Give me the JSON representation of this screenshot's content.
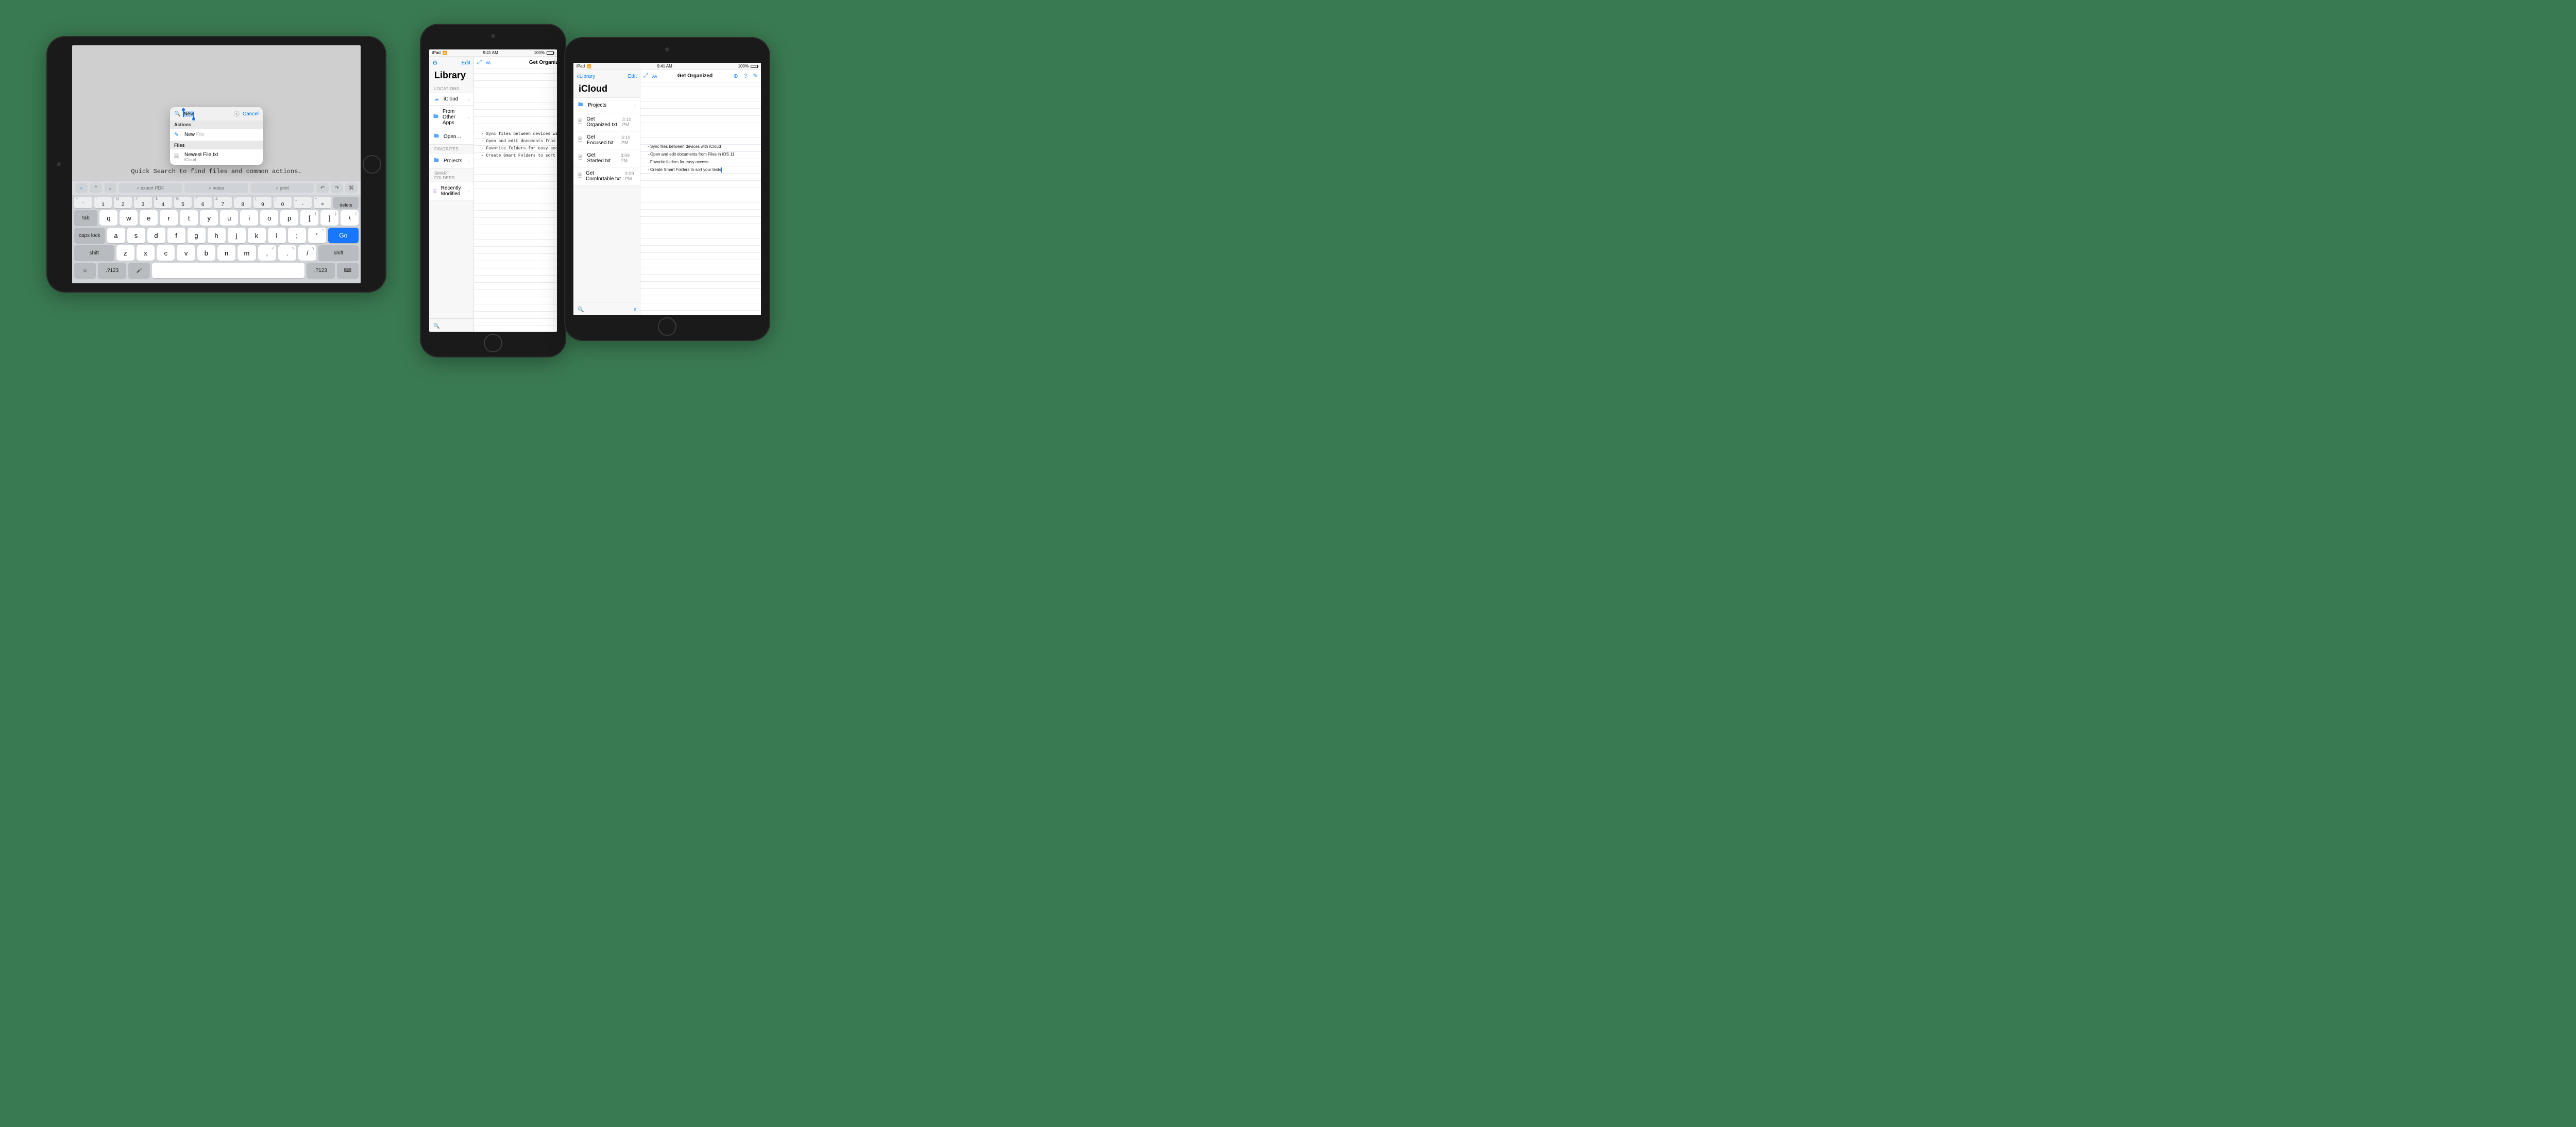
{
  "status": {
    "device": "iPad",
    "time": "9:41 AM",
    "battery": "100%"
  },
  "d1": {
    "caption": "Quick Search to find files and common actions.",
    "popover": {
      "query": "New",
      "cancel": "Cancel",
      "sections": {
        "actions_hdr": "Actions",
        "action_new_prefix": "New",
        "action_new_suffix": " File",
        "files_hdr": "Files",
        "file_name": "Newest File.txt",
        "file_loc": "iCloud"
      }
    },
    "shortcutbar": {
      "pills": [
        "⌕ export PDF",
        "⌕ notes",
        "⌕ print"
      ]
    },
    "keys": {
      "numAlt": [
        "~",
        "!",
        "@",
        "#",
        "$",
        "%",
        "^",
        "&",
        "*",
        "(",
        ")",
        "_",
        "+"
      ],
      "num": [
        "`",
        "1",
        "2",
        "3",
        "4",
        "5",
        "6",
        "7",
        "8",
        "9",
        "0",
        "-",
        "="
      ],
      "delete": "delete",
      "row1": [
        "q",
        "w",
        "e",
        "r",
        "t",
        "y",
        "u",
        "i",
        "o",
        "p"
      ],
      "row1alt": [
        "",
        "",
        "",
        "",
        "",
        "",
        "",
        "",
        "",
        "",
        "{ [",
        "} ]",
        "| \\"
      ],
      "brackets": [
        [
          "{",
          "["
        ],
        [
          "}",
          "]"
        ],
        [
          "|",
          "\\"
        ]
      ],
      "tab": "tab",
      "row2": [
        "a",
        "s",
        "d",
        "f",
        "g",
        "h",
        "j",
        "k",
        "l"
      ],
      "row2extra": [
        [
          ":",
          ";"
        ],
        [
          "\"",
          "'"
        ]
      ],
      "caps": "caps lock",
      "go": "Go",
      "row3": [
        "z",
        "x",
        "c",
        "v",
        "b",
        "n",
        "m"
      ],
      "row3extra": [
        [
          "<",
          ","
        ],
        [
          ">",
          "."
        ],
        [
          "?",
          "/"
        ]
      ],
      "shift": "shift",
      "numsym": ".?123"
    }
  },
  "d2": {
    "leftTitle": "Library",
    "edit": "Edit",
    "sections": {
      "locations": "LOCATIONS",
      "favorites": "FAVORITES",
      "smart": "SMART FOLDERS"
    },
    "locations": [
      {
        "label": "iCloud"
      },
      {
        "label": "From Other Apps"
      },
      {
        "label": "Open…"
      }
    ],
    "favorites": [
      {
        "label": "Projects"
      }
    ],
    "smart": [
      {
        "label": "Recently Modified"
      }
    ],
    "docTitle": "Get Organized",
    "body": "- Sync files between devices with iCloud\n- Open and edit documents from Files in iOS 11\n- Favorite folders for easy access\n- Create Smart Folders to sort your texts"
  },
  "d3": {
    "back": "Library",
    "leftTitle": "iCloud",
    "edit": "Edit",
    "folder": "Projects",
    "files": [
      {
        "name": "Get Organized.txt",
        "time": "3:10 PM"
      },
      {
        "name": "Get Focused.txt",
        "time": "3:10 PM"
      },
      {
        "name": "Get Started.txt",
        "time": "3:09 PM"
      },
      {
        "name": "Get Comfortable.txt",
        "time": "3:09 PM"
      }
    ],
    "docTitle": "Get Organized",
    "body": "- Sync files between devices with iCloud\n- Open and edit documents from Files in iOS 11\n- Favorite folders for easy access\n- Create Smart Folders to sort your texts"
  }
}
